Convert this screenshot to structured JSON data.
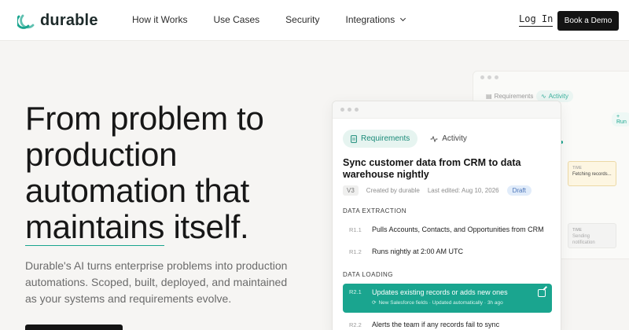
{
  "nav": {
    "logo": "durable",
    "links": [
      "How it Works",
      "Use Cases",
      "Security",
      "Integrations"
    ],
    "login": "Log In",
    "demo": "Book a Demo"
  },
  "hero": {
    "title_1": "From problem to production automation that",
    "title_hl": "maintains",
    "title_2": "itself.",
    "subtitle": "Durable's AI turns enterprise problems into production automations. Scoped, built, deployed, and maintained as your systems and requirements evolve."
  },
  "back_card": {
    "tab_req": "Requirements",
    "tab_act": "Activity",
    "run": "+ Run",
    "box_a_label": "TIME",
    "box_a_text": "Fetching records...",
    "box_b_label": "TIME",
    "box_b_text": "Sending notification"
  },
  "card": {
    "tabs": [
      "Requirements",
      "Activity"
    ],
    "title": "Sync customer data from CRM to data warehouse nightly",
    "version": "V3",
    "created": "Created by durable",
    "edited": "Last edited: Aug 10, 2026",
    "status": "Draft",
    "sections": [
      {
        "name": "DATA EXTRACTION",
        "rows": [
          {
            "id": "R1.1",
            "text": "Pulls Accounts, Contacts, and Opportunities from CRM"
          },
          {
            "id": "R1.2",
            "text": "Runs nightly at 2:00 AM UTC"
          }
        ]
      },
      {
        "name": "DATA LOADING",
        "rows": [
          {
            "id": "R2.1",
            "text": "Updates existing records or adds new ones",
            "sub": "New Salesforce fields · Updated automatically · 3h ago"
          },
          {
            "id": "R2.2",
            "text": "Alerts the team if any records fail to sync"
          }
        ]
      }
    ]
  },
  "colors": {
    "accent": "#1aa58f",
    "dark": "#141414"
  }
}
